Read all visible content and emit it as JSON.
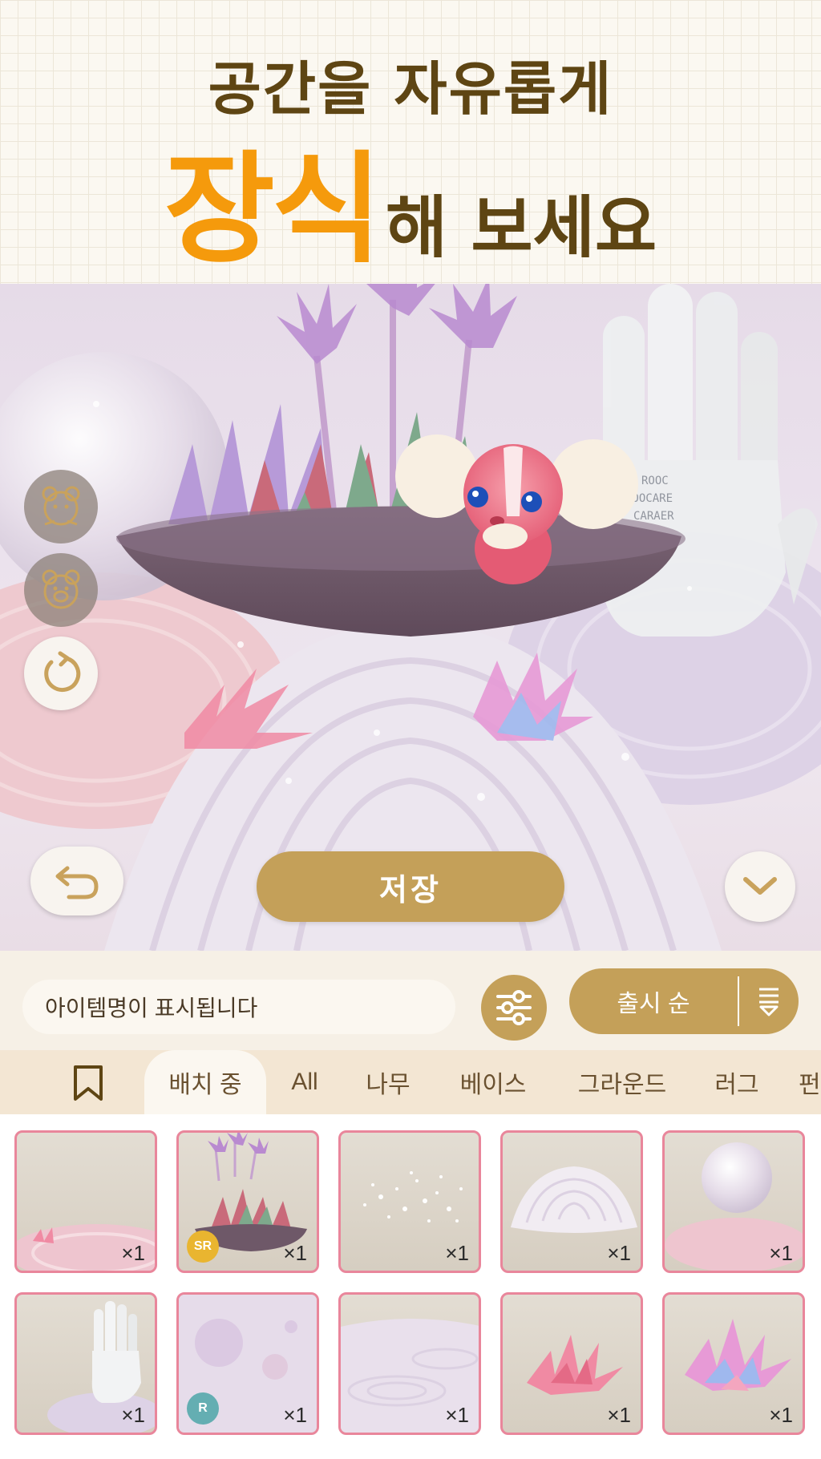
{
  "header": {
    "line1": "공간을 자유롭게",
    "line2_emphasis": "장식",
    "line2_rest": "해 보세요"
  },
  "scene": {
    "save_label": "저장",
    "side_buttons": [
      "bear-outline-icon",
      "bear-outline-icon",
      "rotate-icon"
    ],
    "hand_engraving": "ROOC\nMOOCARE\nCARAER"
  },
  "controls": {
    "item_name_placeholder": "아이템명이 표시됩니다",
    "sort_label": "출시 순"
  },
  "tabs": [
    "배치 중",
    "All",
    "나무",
    "베이스",
    "그라운드",
    "러그",
    "펀"
  ],
  "active_tab": "배치 중",
  "items": [
    {
      "count": "×1",
      "rarity": "",
      "thumb": "pink-sand-base"
    },
    {
      "count": "×1",
      "rarity": "SR",
      "thumb": "plant-bowl"
    },
    {
      "count": "×1",
      "rarity": "",
      "thumb": "sparkles"
    },
    {
      "count": "×1",
      "rarity": "",
      "thumb": "rippled-mound"
    },
    {
      "count": "×1",
      "rarity": "",
      "thumb": "sphere-on-base"
    },
    {
      "count": "×1",
      "rarity": "",
      "thumb": "hand-statue"
    },
    {
      "count": "×1",
      "rarity": "R",
      "thumb": "purple-planets"
    },
    {
      "count": "×1",
      "rarity": "",
      "thumb": "sand-ground"
    },
    {
      "count": "×1",
      "rarity": "",
      "thumb": "pink-spiky-plant"
    },
    {
      "count": "×1",
      "rarity": "",
      "thumb": "rainbow-spiky-plant"
    }
  ],
  "colors": {
    "accent": "#f59a0c",
    "brown_text": "#5e4513",
    "gold_button": "#c4a059",
    "cell_border": "#e9869b",
    "rarity_sr": "#e9b530",
    "rarity_r": "#64aeb2"
  }
}
